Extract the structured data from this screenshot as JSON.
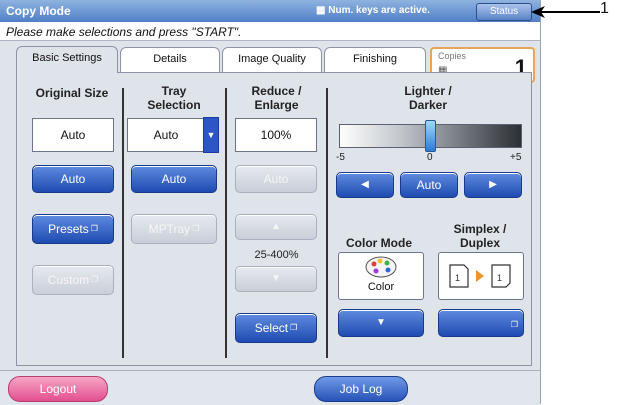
{
  "title": "Copy Mode",
  "num_keys_status": "Num. keys are active.",
  "status_button": "Status",
  "message": "Please make selections and press \"START\".",
  "tabs": [
    {
      "label": "Basic Settings",
      "active": true
    },
    {
      "label": "Details",
      "active": false
    },
    {
      "label": "Image Quality",
      "active": false
    },
    {
      "label": "Finishing",
      "active": false
    }
  ],
  "copies": {
    "label": "Copies",
    "value": "1"
  },
  "original_size": {
    "heading": "Original Size",
    "value": "Auto",
    "auto_button": "Auto",
    "presets_button": "Presets",
    "custom_button": "Custom"
  },
  "tray_selection": {
    "heading_line1": "Tray",
    "heading_line2": "Selection",
    "value": "Auto",
    "auto_button": "Auto",
    "mptray_button": "MPTray"
  },
  "reduce_enlarge": {
    "heading_line1": "Reduce /",
    "heading_line2": "Enlarge",
    "value": "100%",
    "auto_button": "Auto",
    "range_label": "25-400%",
    "select_button": "Select"
  },
  "lighter_darker": {
    "heading_line1": "Lighter /",
    "heading_line2": "Darker",
    "tick_min": "-5",
    "tick_mid": "0",
    "tick_max": "+5",
    "auto_button": "Auto"
  },
  "color_mode": {
    "heading": "Color Mode",
    "value": "Color"
  },
  "simplex_duplex": {
    "heading_line1": "Simplex /",
    "heading_line2": "Duplex"
  },
  "bottom": {
    "logout": "Logout",
    "job_log": "Job Log"
  },
  "callout": "1",
  "colors": {
    "accent_blue": "#1f4bb1",
    "logout_pink": "#e24f8f",
    "copies_border": "#e8a45a"
  }
}
